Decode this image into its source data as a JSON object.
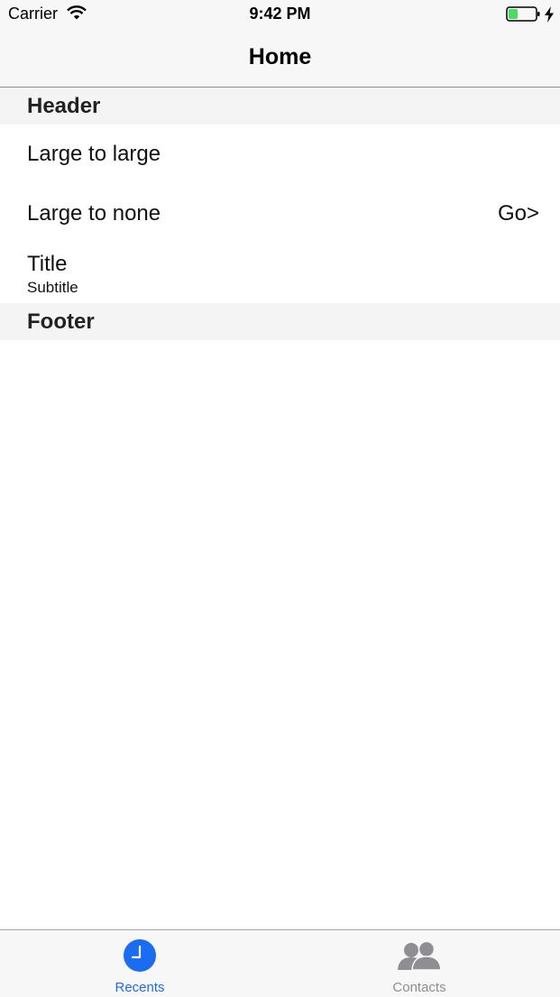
{
  "status_bar": {
    "carrier": "Carrier",
    "time": "9:42 PM",
    "icons": [
      "wifi-icon",
      "battery-icon",
      "charging-bolt-icon"
    ],
    "battery_color": "#4cd964"
  },
  "nav": {
    "title": "Home"
  },
  "table": {
    "header": "Header",
    "rows": [
      {
        "title": "Large to large"
      },
      {
        "title": "Large to none",
        "accessory": "Go>"
      },
      {
        "title": "Title",
        "subtitle": "Subtitle"
      }
    ],
    "footer": "Footer"
  },
  "tab_bar": {
    "tabs": [
      {
        "label": "Recents",
        "icon": "clock-icon",
        "selected": true
      },
      {
        "label": "Contacts",
        "icon": "contacts-icon",
        "selected": false
      }
    ],
    "active_color": "#1a6cf0",
    "inactive_color": "#8e8e93"
  }
}
